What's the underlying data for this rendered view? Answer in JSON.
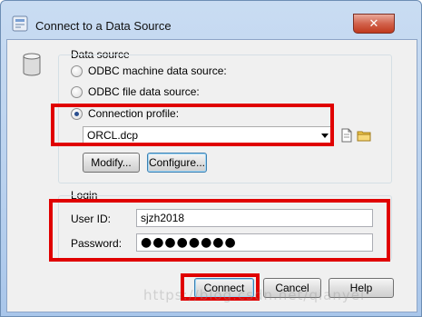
{
  "window": {
    "title": "Connect to a Data Source",
    "close_glyph": "✕",
    "icons": {
      "app": "connect-app-icon",
      "close": "close-icon"
    }
  },
  "data_source": {
    "group_label": "Data source",
    "options": [
      {
        "label": "ODBC machine data source:",
        "checked": false
      },
      {
        "label": "ODBC file data source:",
        "checked": false
      },
      {
        "label": "Connection profile:",
        "checked": true
      }
    ],
    "profile_value": "ORCL.dcp",
    "modify_label": "Modify...",
    "configure_label": "Configure...",
    "icons": {
      "db": "database-icon",
      "new": "new-document-icon",
      "open": "open-folder-icon"
    }
  },
  "login": {
    "group_label": "Login",
    "user_id_label": "User ID:",
    "user_id_value": "sjzh2018",
    "password_label": "Password:",
    "password_value": "●●●●●●●●"
  },
  "buttons": {
    "connect": "Connect",
    "cancel": "Cancel",
    "help": "Help"
  },
  "watermark": "https://blog.csdn.net/qianyel",
  "colors": {
    "highlight": "#e00000",
    "titlebar": "#b9d1ee"
  }
}
